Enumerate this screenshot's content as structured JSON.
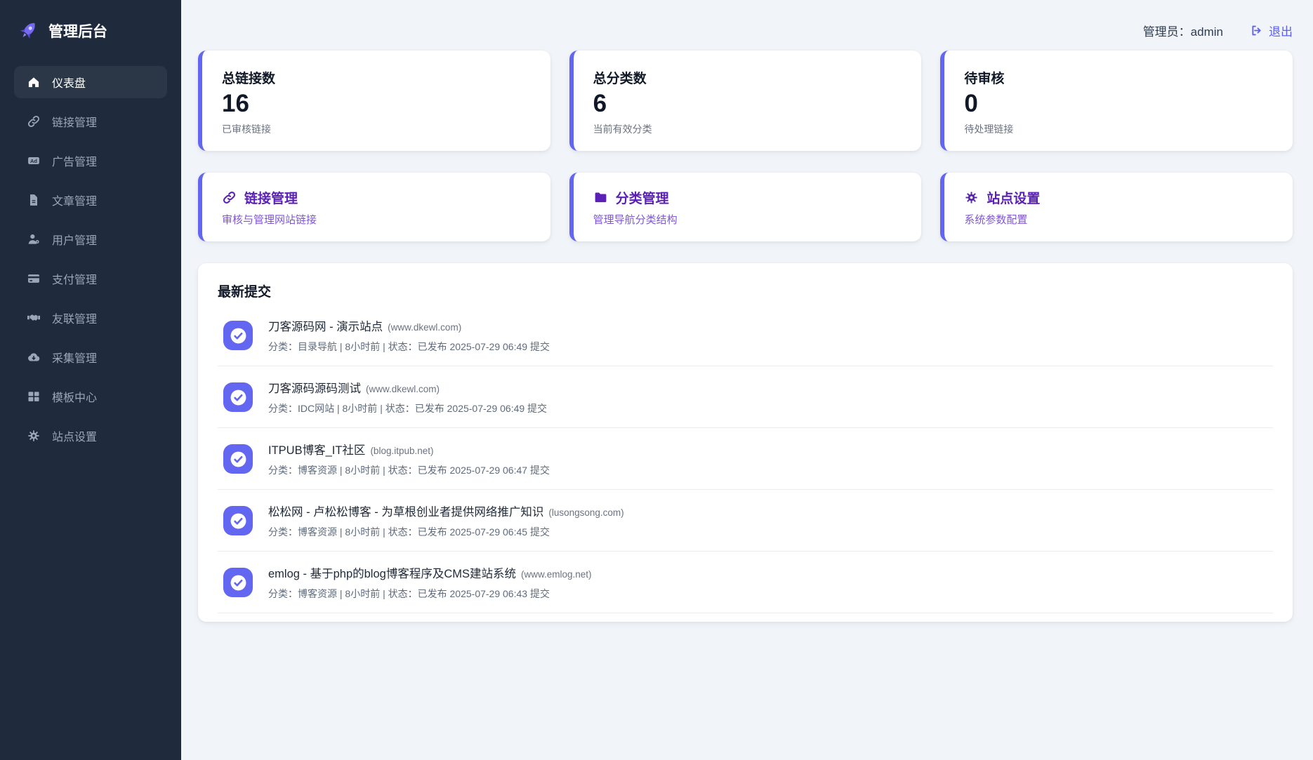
{
  "app": {
    "title": "管理后台"
  },
  "header": {
    "admin_label": "管理员：admin",
    "logout_label": "退出"
  },
  "sidebar": {
    "items": [
      {
        "label": "仪表盘",
        "icon": "home-icon",
        "active": true
      },
      {
        "label": "链接管理",
        "icon": "link-icon",
        "active": false
      },
      {
        "label": "广告管理",
        "icon": "ad-icon",
        "active": false
      },
      {
        "label": "文章管理",
        "icon": "article-icon",
        "active": false
      },
      {
        "label": "用户管理",
        "icon": "user-gear-icon",
        "active": false
      },
      {
        "label": "支付管理",
        "icon": "credit-card-icon",
        "active": false
      },
      {
        "label": "友联管理",
        "icon": "handshake-icon",
        "active": false
      },
      {
        "label": "采集管理",
        "icon": "cloud-download-icon",
        "active": false
      },
      {
        "label": "模板中心",
        "icon": "grid-icon",
        "active": false
      },
      {
        "label": "站点设置",
        "icon": "gear-icon",
        "active": false
      }
    ]
  },
  "stats": [
    {
      "title": "总链接数",
      "value": "16",
      "subtitle": "已审核链接"
    },
    {
      "title": "总分类数",
      "value": "6",
      "subtitle": "当前有效分类"
    },
    {
      "title": "待审核",
      "value": "0",
      "subtitle": "待处理链接"
    }
  ],
  "quick_actions": [
    {
      "title": "链接管理",
      "subtitle": "审核与管理网站链接",
      "icon": "link-icon"
    },
    {
      "title": "分类管理",
      "subtitle": "管理导航分类结构",
      "icon": "folder-icon"
    },
    {
      "title": "站点设置",
      "subtitle": "系统参数配置",
      "icon": "gear-icon"
    }
  ],
  "submissions": {
    "heading": "最新提交",
    "items": [
      {
        "title": "刀客源码网 - 演示站点",
        "domain": "(www.dkewl.com)",
        "meta": "分类：目录导航 | 8小时前 | 状态：已发布 2025-07-29 06:49 提交"
      },
      {
        "title": "刀客源码源码测试",
        "domain": "(www.dkewl.com)",
        "meta": "分类：IDC网站 | 8小时前 | 状态：已发布 2025-07-29 06:49 提交"
      },
      {
        "title": "ITPUB博客_IT社区",
        "domain": "(blog.itpub.net)",
        "meta": "分类：博客资源 | 8小时前 | 状态：已发布 2025-07-29 06:47 提交"
      },
      {
        "title": "松松网 - 卢松松博客 - 为草根创业者提供网络推广知识",
        "domain": "(lusongsong.com)",
        "meta": "分类：博客资源 | 8小时前 | 状态：已发布 2025-07-29 06:45 提交"
      },
      {
        "title": "emlog - 基于php的blog博客程序及CMS建站系统",
        "domain": "(www.emlog.net)",
        "meta": "分类：博客资源 | 8小时前 | 状态：已发布 2025-07-29 06:43 提交"
      }
    ]
  },
  "colors": {
    "accent": "#6366f1",
    "sidebar_bg": "#1f2b3c",
    "sidebar_active_bg": "#2b3747",
    "action_title": "#5b21b6",
    "action_subtitle": "#7e57d0",
    "page_bg": "#f1f5f9"
  }
}
